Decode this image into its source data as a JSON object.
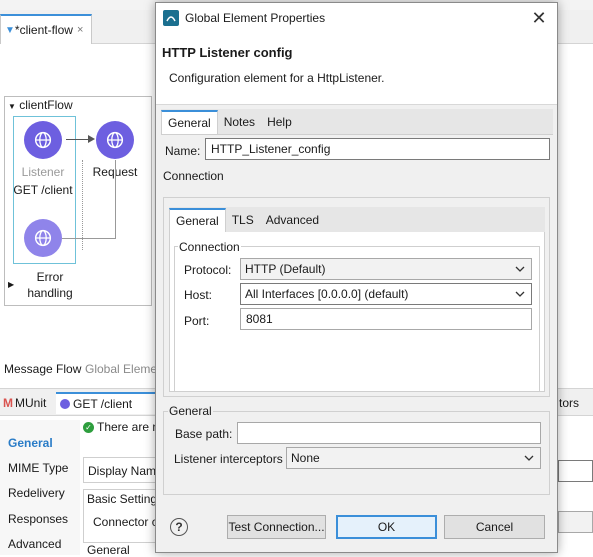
{
  "background": {
    "editor_tab": "*client-flow",
    "editor_tab_close": "×",
    "flow_title": "clientFlow",
    "nodes": {
      "listener_label": "Listener",
      "listener_sub": "GET /client",
      "request_label": "Request",
      "error_label_1": "Error",
      "error_label_2": "handling"
    },
    "bottom_links": {
      "message_flow": "Message Flow",
      "global_elements": "Global Eleme"
    },
    "bottom_tabs": {
      "munit": "MUnit",
      "get_client": "GET /client",
      "right_partial": "tors"
    },
    "sidebar": [
      "General",
      "MIME Type",
      "Redelivery",
      "Responses",
      "Advanced"
    ],
    "props": {
      "status_text": "There are n",
      "display_name": "Display Nam",
      "basic_settings": "Basic Setting",
      "connector": "Connector c",
      "general": "General"
    }
  },
  "dialog": {
    "window_title": "Global Element Properties",
    "header_title": "HTTP Listener config",
    "header_desc": "Configuration element for a HttpListener.",
    "outer_tabs": [
      "General",
      "Notes",
      "Help"
    ],
    "name_label": "Name:",
    "name_value": "HTTP_Listener_config",
    "connection_section": "Connection",
    "inner_tabs": [
      "General",
      "TLS",
      "Advanced"
    ],
    "connection_group": "Connection",
    "protocol_label": "Protocol:",
    "protocol_value": "HTTP (Default)",
    "host_label": "Host:",
    "host_value": "All Interfaces [0.0.0.0] (default)",
    "port_label": "Port:",
    "port_value": "8081",
    "general_group": "General",
    "base_path_label": "Base path:",
    "base_path_value": "",
    "listener_interceptors_label": "Listener interceptors",
    "listener_interceptors_value": "None",
    "help_symbol": "?",
    "buttons": {
      "test_connection": "Test Connection...",
      "ok": "OK",
      "cancel": "Cancel"
    }
  },
  "colors": {
    "accent": "#3b8fd9",
    "node": "#6d5fe0",
    "status_ok": "#2e9e3e"
  }
}
